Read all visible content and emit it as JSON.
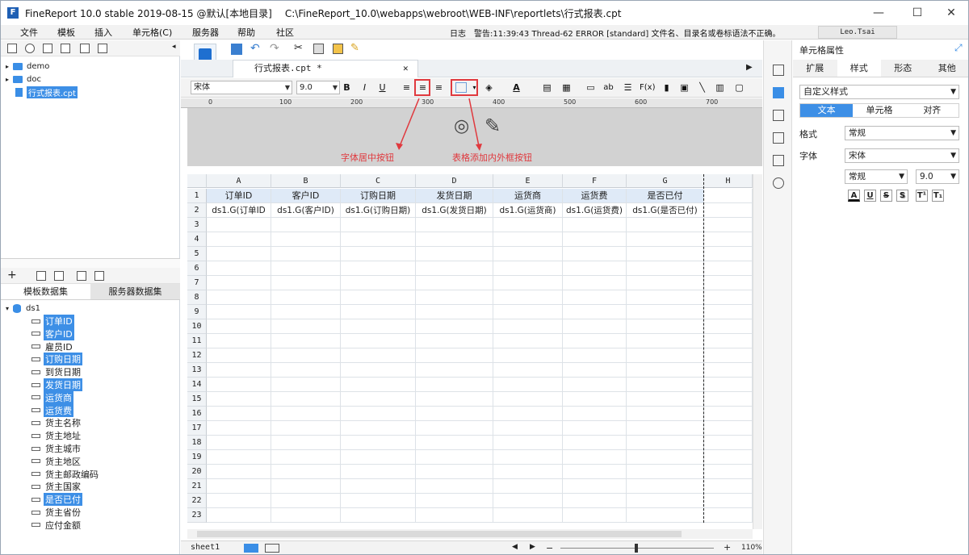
{
  "window": {
    "title": "FineReport 10.0 stable 2019-08-15 @默认[本地目录]",
    "path": "C:\\FineReport_10.0\\webapps\\webroot\\WEB-INF\\reportlets\\行式报表.cpt",
    "minimize": "—",
    "maximize": "☐",
    "close": "✕"
  },
  "menu": {
    "items": [
      "文件",
      "模板",
      "插入",
      "单元格(C)",
      "服务器",
      "帮助",
      "社区"
    ],
    "log_label": "日志",
    "log_message": "警告:11:39:43 Thread-62 ERROR [standard] 文件名、目录名或卷标语法不正确。",
    "user": "Leo.Tsai"
  },
  "tree": {
    "items": [
      "demo",
      "doc",
      "行式报表.cpt"
    ]
  },
  "dataset": {
    "tabs": [
      "模板数据集",
      "服务器数据集"
    ],
    "name": "ds1",
    "fields": [
      {
        "name": "订单ID",
        "hl": true
      },
      {
        "name": "客户ID",
        "hl": true
      },
      {
        "name": "雇员ID",
        "hl": false
      },
      {
        "name": "订购日期",
        "hl": true
      },
      {
        "name": "到货日期",
        "hl": false
      },
      {
        "name": "发货日期",
        "hl": true
      },
      {
        "name": "运货商",
        "hl": true
      },
      {
        "name": "运货费",
        "hl": true
      },
      {
        "name": "货主名称",
        "hl": false
      },
      {
        "name": "货主地址",
        "hl": false
      },
      {
        "name": "货主城市",
        "hl": false
      },
      {
        "name": "货主地区",
        "hl": false
      },
      {
        "name": "货主邮政编码",
        "hl": false
      },
      {
        "name": "货主国家",
        "hl": false
      },
      {
        "name": "是否已付",
        "hl": true
      },
      {
        "name": "货主省份",
        "hl": false
      },
      {
        "name": "应付金额",
        "hl": false
      }
    ]
  },
  "editor": {
    "file_tab": "行式报表.cpt *",
    "font": "宋体",
    "size": "9.0",
    "ruler_ticks": [
      "0",
      "100",
      "200",
      "300",
      "400",
      "500",
      "600",
      "700"
    ],
    "annotation_center": "字体居中按钮",
    "annotation_border": "表格添加内外框按钮",
    "columns": [
      "A",
      "B",
      "C",
      "D",
      "E",
      "F",
      "G",
      "H"
    ],
    "header_row": [
      "订单ID",
      "客户ID",
      "订购日期",
      "发货日期",
      "运货商",
      "运货费",
      "是否已付"
    ],
    "data_row": [
      "ds1.G(订单ID",
      "ds1.G(客户ID)",
      "ds1.G(订购日期)",
      "ds1.G(发货日期)",
      "ds1.G(运货商)",
      "ds1.G(运货费)",
      "ds1.G(是否已付)"
    ],
    "row_count": 23,
    "sheet": "sheet1",
    "zoom": "110%"
  },
  "props": {
    "title": "单元格属性",
    "tabs": [
      "扩展",
      "样式",
      "形态",
      "其他"
    ],
    "active_tab": 1,
    "style_select": "自定义样式",
    "subtabs": [
      "文本",
      "单元格",
      "对齐"
    ],
    "format_label": "格式",
    "format_value": "常规",
    "font_label": "字体",
    "font_value": "宋体",
    "style_value": "常规",
    "size_value": "9.0",
    "font_buttons": [
      "A",
      "U",
      "S",
      "S",
      "T¹",
      "T₁"
    ]
  }
}
